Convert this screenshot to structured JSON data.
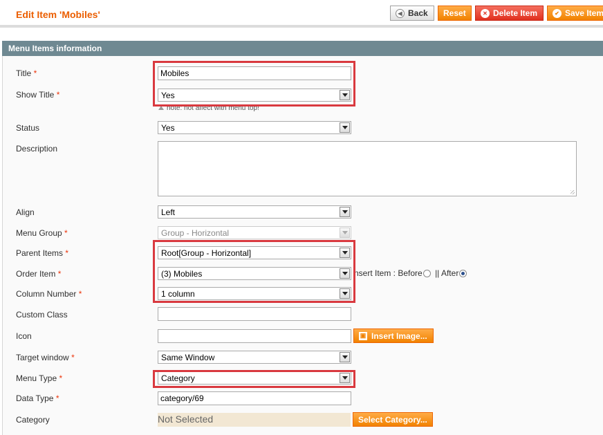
{
  "header": {
    "title": "Edit Item 'Mobiles'",
    "back_label": "Back",
    "reset_label": "Reset",
    "delete_label": "Delete Item",
    "save_label": "Save Item"
  },
  "section": {
    "title": "Menu Items information"
  },
  "form": {
    "required_mark": "*",
    "title_label": "Title",
    "title_value": "Mobiles",
    "show_title_label": "Show Title",
    "show_title_value": "Yes",
    "show_title_note": "note: not affect with menu top!",
    "status_label": "Status",
    "status_value": "Yes",
    "description_label": "Description",
    "align_label": "Align",
    "align_value": "Left",
    "menu_group_label": "Menu Group",
    "menu_group_value": "Group - Horizontal",
    "parent_items_label": "Parent Items",
    "parent_items_value": "Root[Group - Horizontal]",
    "order_item_label": "Order Item",
    "order_item_value": "(3) Mobiles",
    "insert_item_label": "nsert Item : Before",
    "insert_after_label": "|| After",
    "column_number_label": "Column Number",
    "column_number_value": "1 column",
    "custom_class_label": "Custom Class",
    "icon_label": "Icon",
    "insert_image_label": "Insert Image...",
    "target_window_label": "Target window",
    "target_window_value": "Same Window",
    "menu_type_label": "Menu Type",
    "menu_type_value": "Category",
    "data_type_label": "Data Type",
    "data_type_value": "category/69",
    "category_label": "Category",
    "category_value": "Not Selected",
    "select_category_label": "Select Category..."
  },
  "colors": {
    "title_orange": "#eb5e00",
    "section_header": "#6f8992",
    "button_orange": "#f18200",
    "delete_red": "#e0301e",
    "highlight_red": "#d9393f",
    "required_red": "#eb340a"
  }
}
